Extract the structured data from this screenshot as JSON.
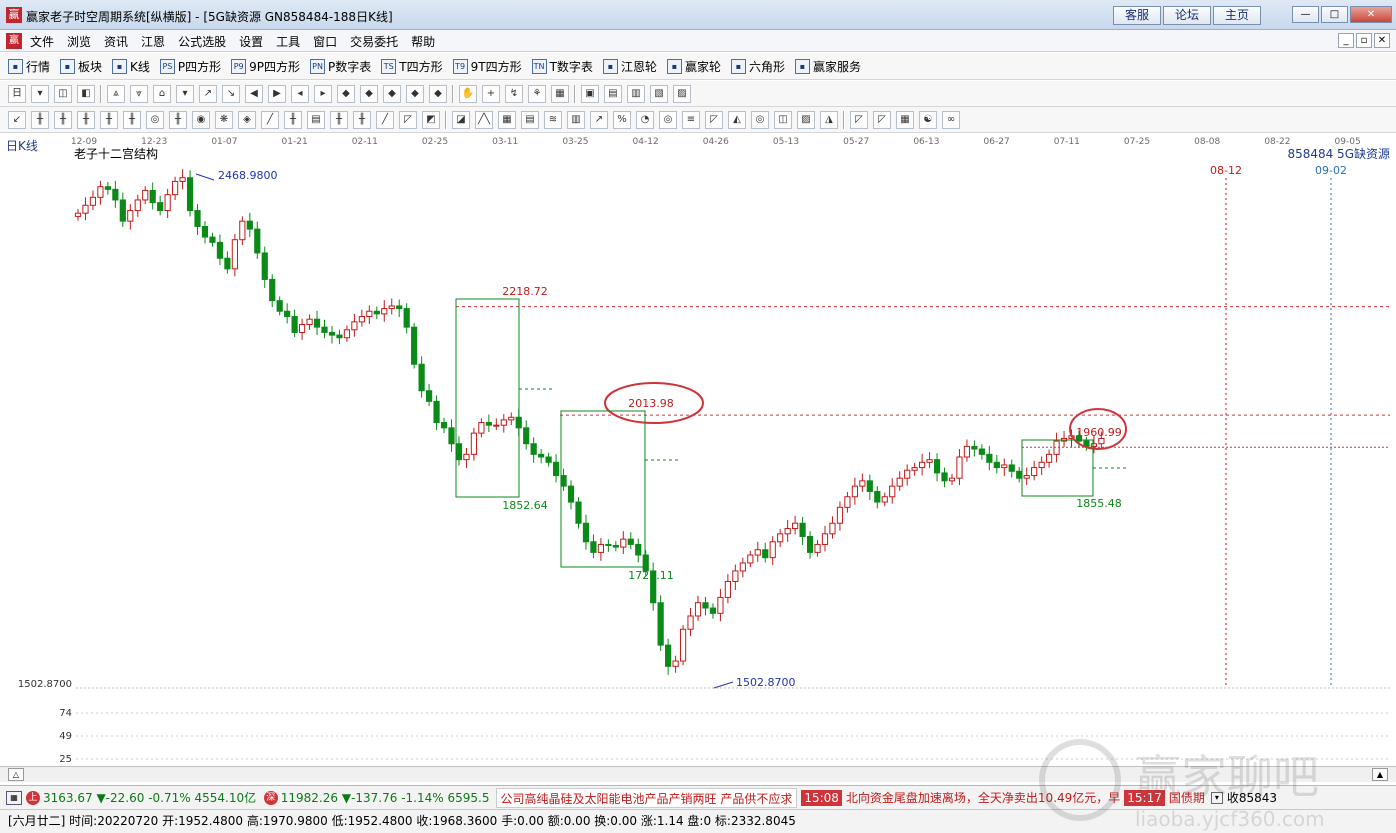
{
  "window": {
    "title": "赢家老子时空周期系统[纵横版] - [5G缺资源  GN858484-188日K线]",
    "links": [
      "客服",
      "论坛",
      "主页"
    ],
    "controls": [
      "—",
      "□",
      "✕"
    ]
  },
  "menu": {
    "items": [
      "文件",
      "浏览",
      "资讯",
      "江恩",
      "公式选股",
      "设置",
      "工具",
      "窗口",
      "交易委托",
      "帮助"
    ],
    "mdi_controls": [
      "_",
      "▫",
      "✕"
    ]
  },
  "toolbar_main": [
    {
      "label": "行情",
      "icon": "grid-icon"
    },
    {
      "label": "板块",
      "icon": "blocks-icon"
    },
    {
      "label": "K线",
      "icon": "candles-icon"
    },
    {
      "label": "P四方形",
      "icon": "ps-icon",
      "abbr": "PS"
    },
    {
      "label": "9P四方形",
      "icon": "p9-icon",
      "abbr": "P9"
    },
    {
      "label": "P数字表",
      "icon": "pn-icon",
      "abbr": "PN"
    },
    {
      "label": "T四方形",
      "icon": "ts-icon",
      "abbr": "TS"
    },
    {
      "label": "9T四方形",
      "icon": "t9-icon",
      "abbr": "T9"
    },
    {
      "label": "T数字表",
      "icon": "tn-icon",
      "abbr": "TN"
    },
    {
      "label": "江恩轮",
      "icon": "gann-wheel-icon"
    },
    {
      "label": "赢家轮",
      "icon": "winner-wheel-icon"
    },
    {
      "label": "六角形",
      "icon": "hexagon-icon"
    },
    {
      "label": "赢家服务",
      "icon": "dollar-icon"
    }
  ],
  "chart_header": {
    "period": "日K线",
    "indicator": "老子十二宫结构",
    "code_name": "858484 5G缺资源"
  },
  "chart_data": {
    "type": "candlestick",
    "date_axis": [
      "12-09",
      "12-23",
      "01-07",
      "01-21",
      "02-11",
      "02-25",
      "03-11",
      "03-25",
      "04-12",
      "04-26",
      "05-13",
      "05-27",
      "06-13",
      "06-27",
      "07-11",
      "07-25",
      "08-08",
      "08-22",
      "09-05"
    ],
    "future_markers": [
      "08-12",
      "09-02"
    ],
    "price_range": [
      1502.87,
      2468.98
    ],
    "high_label": "2468.9800",
    "low_label": "1502.8700",
    "axis_low_label": "1502.8700",
    "levels": [
      "2218.72",
      "2013.98",
      "1960.99"
    ],
    "box_labels": [
      "1852.64",
      "1725.11",
      "1855.48"
    ],
    "sub_axis": [
      "74",
      "49",
      "25"
    ],
    "closes": [
      2395,
      2410,
      2425,
      2445,
      2440,
      2420,
      2380,
      2400,
      2420,
      2438,
      2415,
      2400,
      2430,
      2455,
      2462,
      2400,
      2370,
      2350,
      2340,
      2310,
      2290,
      2345,
      2380,
      2365,
      2320,
      2270,
      2230,
      2210,
      2200,
      2170,
      2185,
      2195,
      2180,
      2170,
      2165,
      2160,
      2175,
      2190,
      2200,
      2210,
      2205,
      2215,
      2220,
      2215,
      2180,
      2110,
      2060,
      2040,
      2000,
      1990,
      1960,
      1930,
      1940,
      1980,
      2000,
      1995,
      1995,
      2005,
      2010,
      1990,
      1960,
      1940,
      1935,
      1925,
      1900,
      1880,
      1850,
      1810,
      1775,
      1755,
      1770,
      1768,
      1765,
      1780,
      1770,
      1750,
      1720,
      1660,
      1580,
      1540,
      1550,
      1610,
      1635,
      1660,
      1650,
      1640,
      1670,
      1700,
      1720,
      1735,
      1750,
      1760,
      1745,
      1775,
      1790,
      1800,
      1810,
      1785,
      1755,
      1770,
      1790,
      1810,
      1840,
      1860,
      1880,
      1890,
      1870,
      1850,
      1860,
      1880,
      1895,
      1910,
      1915,
      1925,
      1930,
      1905,
      1890,
      1895,
      1935,
      1955,
      1950,
      1940,
      1925,
      1915,
      1920,
      1908,
      1895,
      1900,
      1915,
      1925,
      1940,
      1965,
      1970,
      1975,
      1965,
      1955,
      1960,
      1970
    ]
  },
  "status": {
    "sh_index": "3163.67",
    "sh_change": "▼-22.60",
    "sh_pct": "-0.71%",
    "sh_amount": "4554.10亿",
    "sz_index": "11982.26",
    "sz_change": "▼-137.76",
    "sz_pct": "-1.14%",
    "sz_amount": "6595.5",
    "news1": "公司高纯晶硅及太阳能电池产品产销两旺 产品供不应求",
    "time1": "15:08",
    "news2": "北向资金尾盘加速离场，全天净卖出10.49亿元，早",
    "time2": "15:17",
    "news3": "国债期",
    "tail": "收85843"
  },
  "bar_info": {
    "text": "[六月廿二] 时间:20220720 开:1952.4800 高:1970.9800 低:1952.4800 收:1968.3600 手:0.00 额:0.00 换:0.00 涨:1.14 盘:0 标:2332.8045"
  },
  "watermark": {
    "text": "赢家聊吧",
    "url": "liaoba.yjcf360.com"
  },
  "colors": {
    "up": "#c31a1a",
    "down": "#0b8a18",
    "grid": "#c8c8c8",
    "level": "#d0343b"
  }
}
